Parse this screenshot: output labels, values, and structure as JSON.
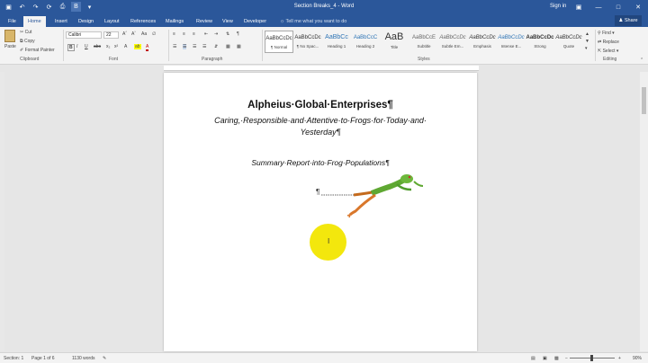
{
  "window": {
    "title": "Section Breaks_4  -  Word",
    "signin": "Sign in"
  },
  "qat": {
    "icons": [
      "save-icon",
      "undo-icon",
      "redo-icon",
      "refresh-icon",
      "print-icon",
      "bold-icon",
      "customize-icon"
    ]
  },
  "tabs": [
    "File",
    "Home",
    "Insert",
    "Design",
    "Layout",
    "References",
    "Mailings",
    "Review",
    "View",
    "Developer"
  ],
  "tellme": "Tell me what you want to do",
  "share": "Share",
  "clipboard": {
    "paste": "Paste",
    "cut": "Cut",
    "copy": "Copy",
    "format_painter": "Format Painter",
    "label": "Clipboard"
  },
  "font": {
    "name": "Calibri",
    "size": "22",
    "label": "Font"
  },
  "paragraph": {
    "label": "Paragraph"
  },
  "styles": {
    "label": "Styles",
    "items": [
      {
        "sample": "AaBbCcDc",
        "name": "¶ Normal"
      },
      {
        "sample": "AaBbCcDc",
        "name": "¶ No Spac..."
      },
      {
        "sample": "AaBbCc",
        "name": "Heading 1"
      },
      {
        "sample": "AaBbCcC",
        "name": "Heading 2"
      },
      {
        "sample": "AaB",
        "name": "Title"
      },
      {
        "sample": "AaBbCcE",
        "name": "Subtitle"
      },
      {
        "sample": "AaBbCcDc",
        "name": "Subtle Em..."
      },
      {
        "sample": "AaBbCcDc",
        "name": "Emphasis"
      },
      {
        "sample": "AaBbCcDc",
        "name": "Intense E..."
      },
      {
        "sample": "AaBbCcDc",
        "name": "Strong"
      },
      {
        "sample": "AaBbCcDc",
        "name": "Quote"
      }
    ]
  },
  "editing": {
    "find": "Find",
    "replace": "Replace",
    "select": "Select",
    "label": "Editing"
  },
  "document": {
    "title": "Alpheius·Global·Enterprises¶",
    "subtitle_line1": "Caring,·Responsible·and·Attentive·to·Frogs·for·Today·and·",
    "subtitle_line2": "Yesterday¶",
    "report": "Summary·Report·into·Frog·Populations¶",
    "pilcrow": "¶"
  },
  "status": {
    "section": "Section: 1",
    "page": "Page 1 of 6",
    "words": "1130 words",
    "zoom": "90%"
  },
  "colors": {
    "accent": "#2b579a",
    "highlight": "#f2e600"
  }
}
